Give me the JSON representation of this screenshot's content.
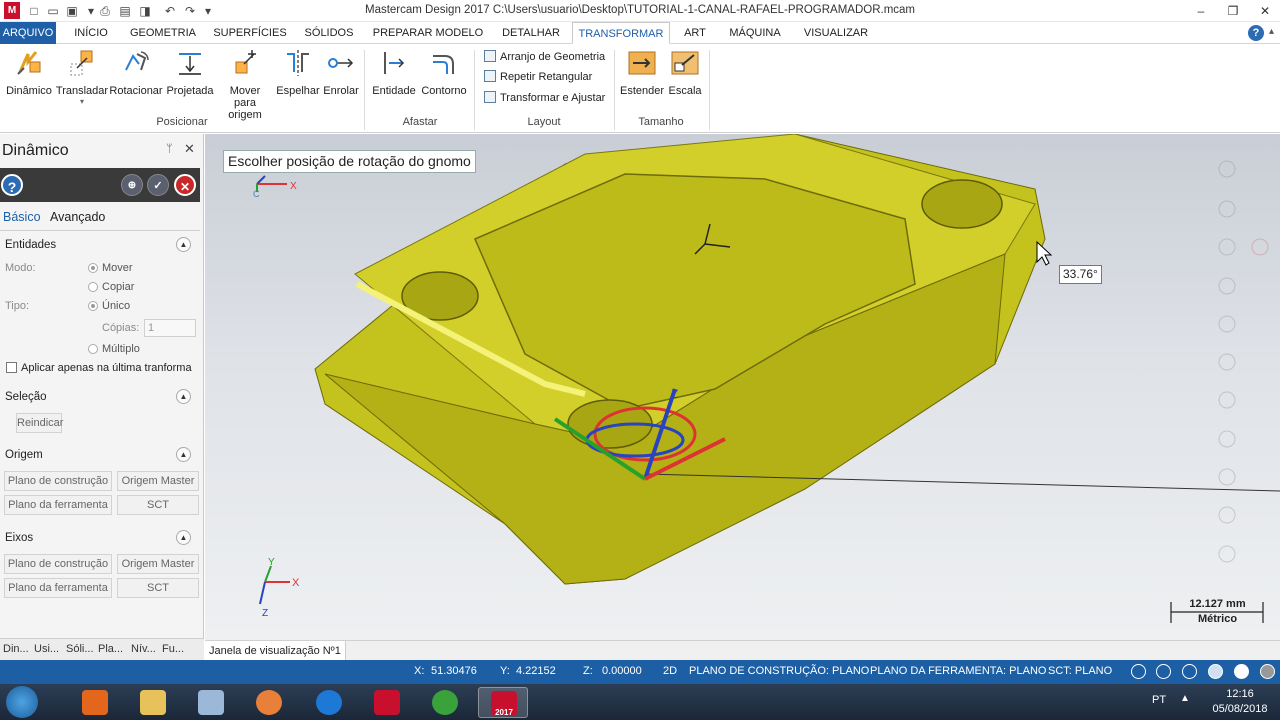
{
  "window": {
    "title": "Mastercam Design 2017  C:\\Users\\usuario\\Desktop\\TUTORIAL-1-CANAL-RAFAEL-PROGRAMADOR.mcam"
  },
  "menu": {
    "tabs": [
      "ARQUIVO",
      "INÍCIO",
      "GEOMETRIA",
      "SUPERFÍCIES",
      "SÓLIDOS",
      "PREPARAR MODELO",
      "DETALHAR",
      "TRANSFORMAR",
      "ART",
      "MÁQUINA",
      "VISUALIZAR"
    ],
    "active": "TRANSFORMAR"
  },
  "ribbon": {
    "posicionar": {
      "label": "Posicionar",
      "buttons": [
        "Dinâmico",
        "Transladar",
        "Rotacionar",
        "Projetada",
        "Mover para origem",
        "Espelhar",
        "Enrolar"
      ]
    },
    "afastar": {
      "label": "Afastar",
      "buttons": [
        "Entidade",
        "Contorno"
      ]
    },
    "layout": {
      "label": "Layout",
      "buttons": [
        "Arranjo de Geometria",
        "Repetir Retangular",
        "Transformar e Ajustar"
      ]
    },
    "tamanho": {
      "label": "Tamanho",
      "buttons": [
        "Estender",
        "Escala"
      ]
    }
  },
  "panel": {
    "title": "Dinâmico",
    "tabs": [
      "Básico",
      "Avançado"
    ],
    "entidades": {
      "label": "Entidades",
      "modo_label": "Modo:",
      "modo_options": [
        "Mover",
        "Copiar"
      ],
      "modo_selected": "Mover",
      "tipo_label": "Tipo:",
      "tipo_selected": "Único",
      "tipo_options": [
        "Único",
        "Múltiplo"
      ],
      "copias_label": "Cópias:",
      "copias_value": "1",
      "apply_last_label": "Aplicar apenas na última tranforma"
    },
    "selecao": {
      "label": "Seleção",
      "reset_button": "Reindicar"
    },
    "origem": {
      "label": "Origem",
      "buttons": [
        "Plano de construção",
        "Origem Master",
        "Plano da ferramenta",
        "SCT"
      ]
    },
    "eixos": {
      "label": "Eixos",
      "buttons": [
        "Plano de construção",
        "Origem Master",
        "Plano da ferramenta",
        "SCT"
      ]
    },
    "bottom_tabs": [
      "Din...",
      "Usi...",
      "Sóli...",
      "Pla...",
      "Nív...",
      "Fu..."
    ]
  },
  "viewport": {
    "prompt": "Escolher posição de rotação do gnomo",
    "angle": "33.76°",
    "scale_value": "12.127 mm",
    "scale_unit": "Métrico",
    "tab": "Janela de visualização Nº1",
    "gnomon_labels": {
      "x": "X",
      "y": "Y",
      "z": "Z",
      "c": "C"
    },
    "model_color": "#c8c61e"
  },
  "status": {
    "x_label": "X:",
    "x_value": "51.30476",
    "y_label": "Y:",
    "y_value": "4.22152",
    "z_label": "Z:",
    "z_value": "0.00000",
    "mode": "2D",
    "construction_plane": "PLANO DE CONSTRUÇÃO: PLANO",
    "tool_plane": "PLANO DA FERRAMENTA: PLANO",
    "sct": "SCT: PLANO"
  },
  "taskbar": {
    "language": "PT",
    "time": "12:16",
    "date": "05/08/2018",
    "mastercam_badge": "2017"
  }
}
